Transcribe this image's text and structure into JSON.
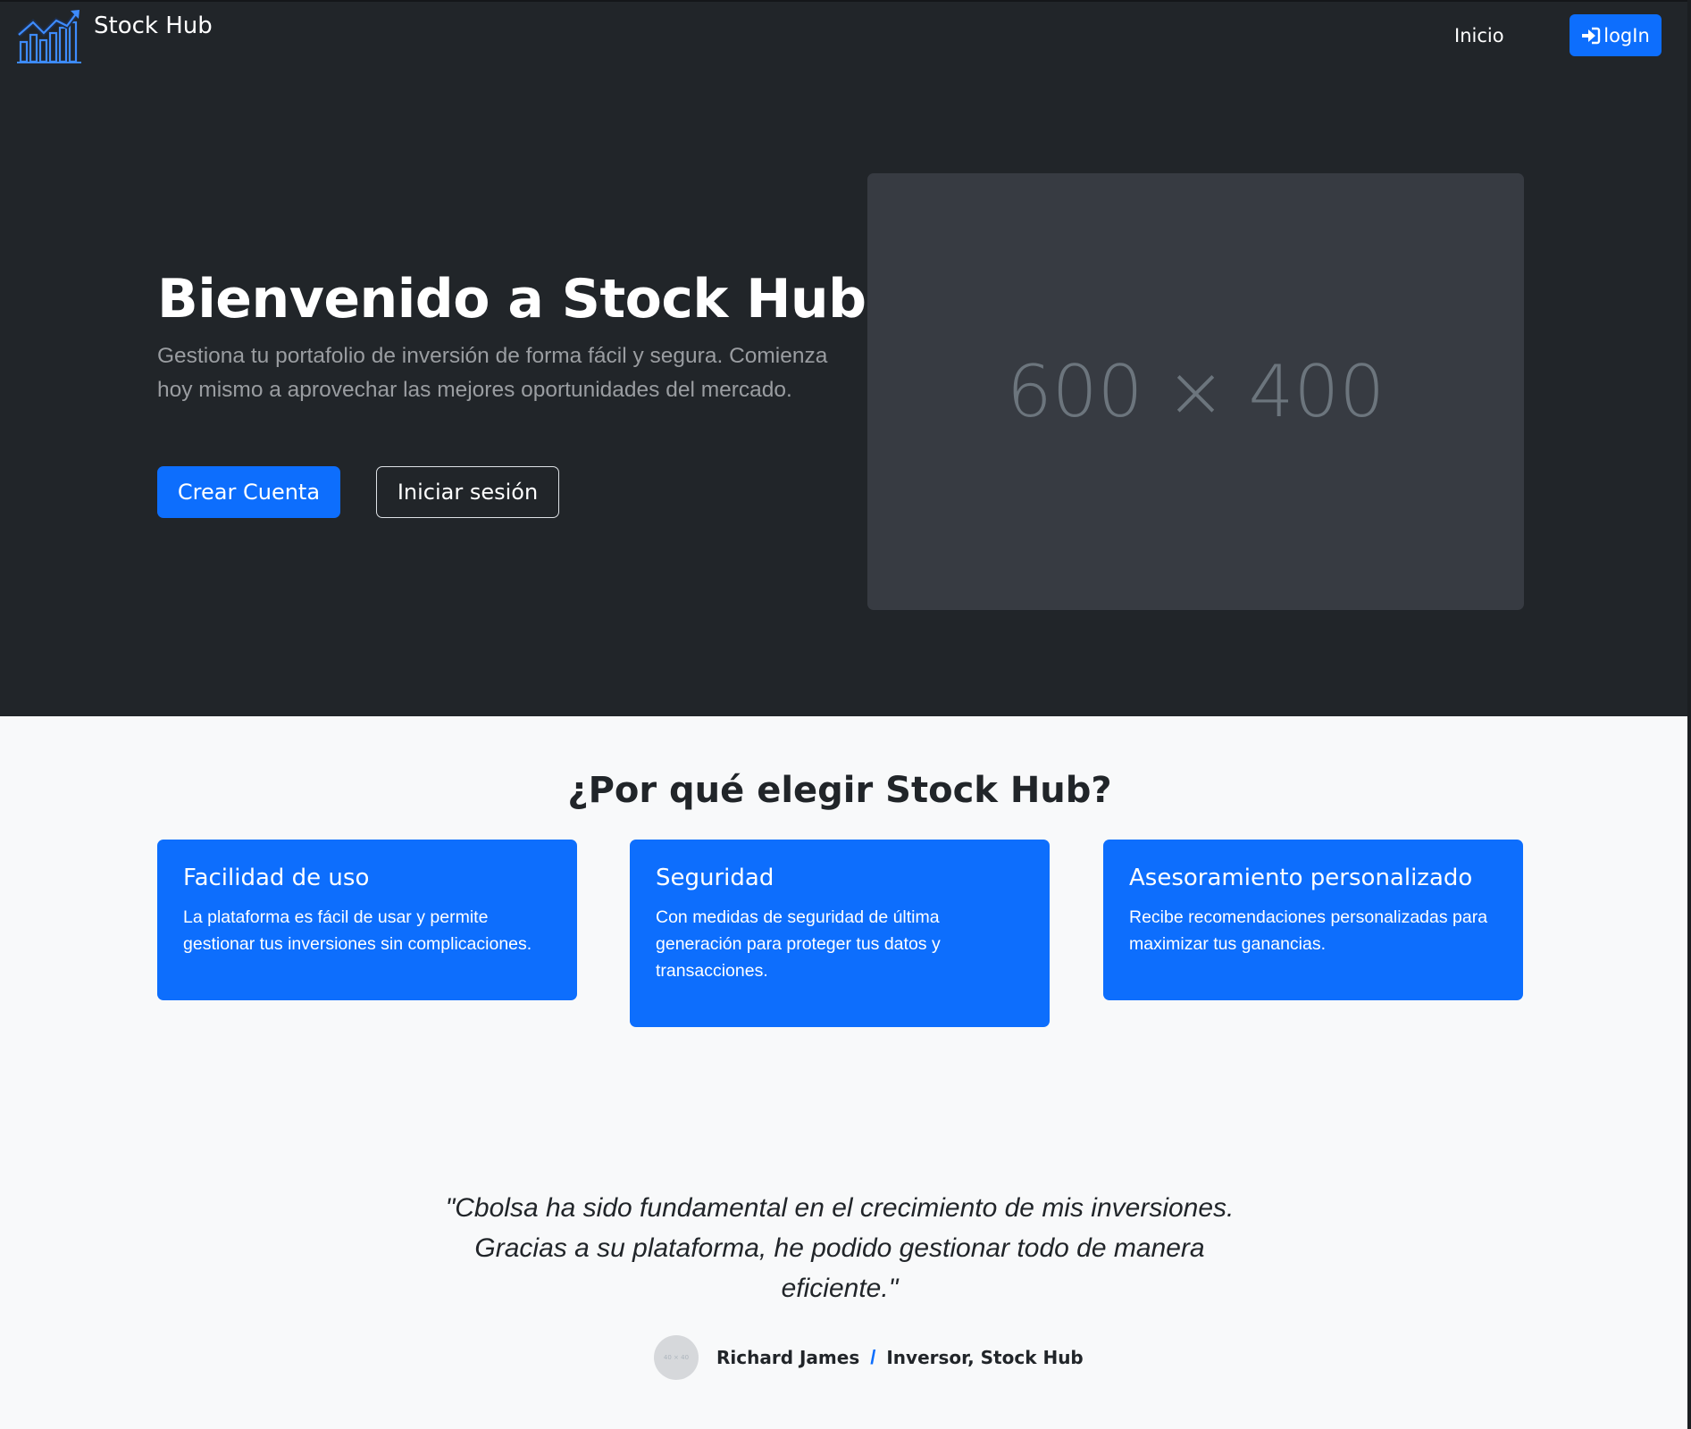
{
  "navbar": {
    "brand": "Stock Hub",
    "logo_icon": "stock-chart-logo-icon",
    "home_link": "Inicio",
    "login_icon": "sign-in-icon",
    "login_label": "logIn"
  },
  "hero": {
    "title": "Bienvenido a Stock Hub",
    "lead": "Gestiona tu portafolio de inversión de forma fácil y segura. Comienza hoy mismo a aprovechar las mejores oportunidades del mercado.",
    "primary_button": "Crear Cuenta",
    "secondary_button": "Iniciar sesión",
    "image_placeholder": "600 × 400"
  },
  "features": {
    "title": "¿Por qué elegir Stock Hub?",
    "cards": [
      {
        "title": "Facilidad de uso",
        "text": "La plataforma es fácil de usar y permite gestionar tus inversiones sin complicaciones."
      },
      {
        "title": "Seguridad",
        "text": "Con medidas de seguridad de última generación para proteger tus datos y transacciones."
      },
      {
        "title": "Asesoramiento personalizado",
        "text": "Recibe recomendaciones personalizadas para maximizar tus ganancias."
      }
    ]
  },
  "testimonial": {
    "quote": "\"Cbolsa ha sido fundamental en el crecimiento de mis inversiones. Gracias a su plataforma, he podido gestionar todo de manera eficiente.\"",
    "avatar_text": "40 × 40",
    "author_name": "Richard James",
    "separator": "/",
    "author_role": "Inversor, Stock Hub"
  },
  "colors": {
    "primary": "#0d6efd",
    "dark_bg": "#212529",
    "light_bg": "#f8f9fa",
    "placeholder_bg": "#373b42"
  }
}
